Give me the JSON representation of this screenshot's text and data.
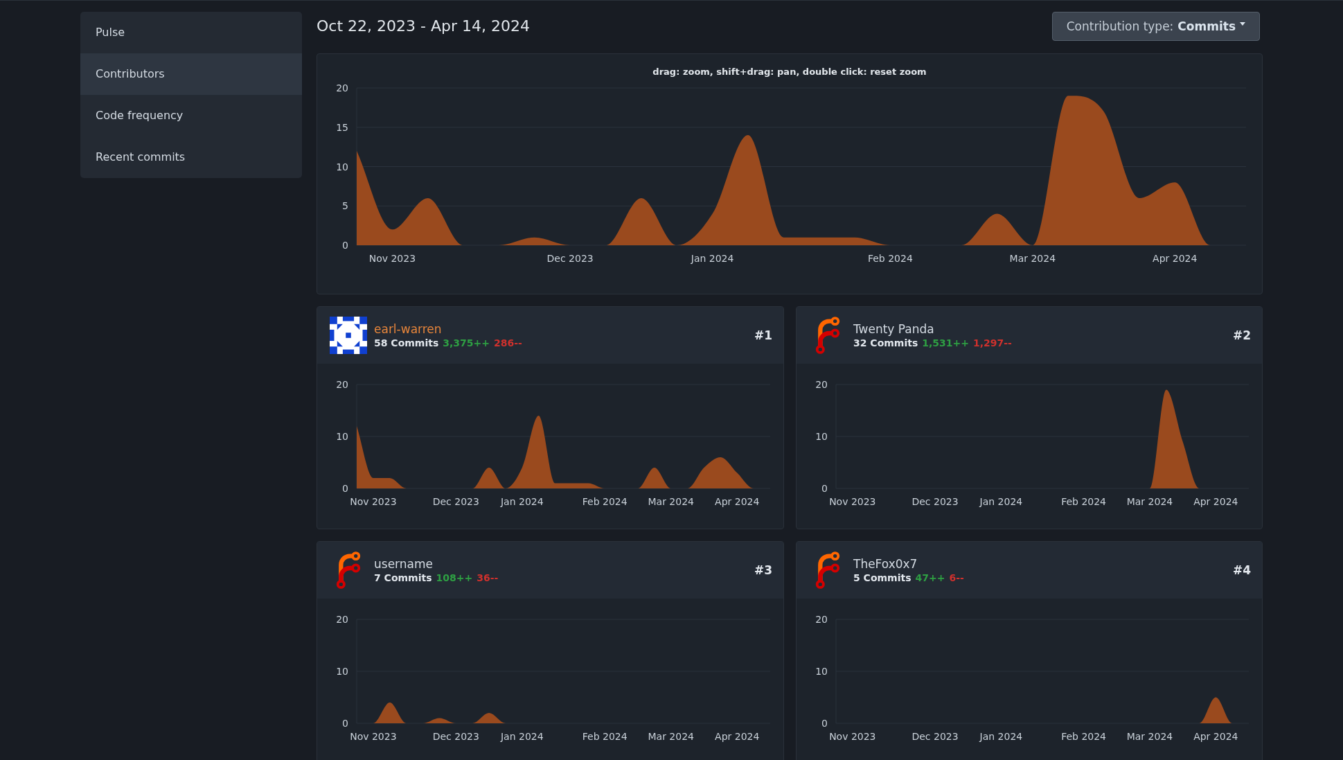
{
  "sidebar": {
    "items": [
      {
        "label": "Pulse",
        "selected": false
      },
      {
        "label": "Contributors",
        "selected": true
      },
      {
        "label": "Code frequency",
        "selected": false
      },
      {
        "label": "Recent commits",
        "selected": false
      }
    ]
  },
  "header": {
    "date_range": "Oct 22, 2023 - Apr 14, 2024",
    "contribution_button": {
      "label": "Contribution type:",
      "value": "Commits"
    }
  },
  "main_chart": {
    "chart_data": {
      "type": "area",
      "title": "drag: zoom, shift+drag: pan, double click: reset zoom",
      "categories": [
        null,
        "Nov 2023",
        null,
        null,
        null,
        null,
        "Dec 2023",
        null,
        null,
        null,
        "Jan 2024",
        null,
        null,
        null,
        null,
        "Feb 2024",
        null,
        null,
        null,
        "Mar 2024",
        null,
        null,
        null,
        "Apr 2024",
        null,
        null
      ],
      "values": [
        12,
        2,
        6,
        0,
        0,
        1,
        0,
        0,
        6,
        0,
        4,
        14,
        1,
        1,
        1,
        0,
        0,
        0,
        4,
        0,
        19,
        17,
        6,
        8,
        0,
        0
      ],
      "ylim": [
        0,
        20
      ],
      "yticks": [
        0,
        5,
        10,
        15,
        20
      ],
      "grid": true
    }
  },
  "contributors": [
    {
      "kind": "identicon",
      "name": "earl-warren",
      "link": true,
      "commits": "58 Commits",
      "additions": "3,375++",
      "deletions": "286--",
      "rank": "#1",
      "chart_data": {
        "type": "area",
        "categories": [
          null,
          "Nov 2023",
          null,
          null,
          null,
          null,
          "Dec 2023",
          null,
          null,
          null,
          "Jan 2024",
          null,
          null,
          null,
          null,
          "Feb 2024",
          null,
          null,
          null,
          "Mar 2024",
          null,
          null,
          null,
          "Apr 2024",
          null,
          null
        ],
        "values": [
          12,
          2,
          2,
          0,
          0,
          0,
          0,
          0,
          4,
          0,
          4,
          14,
          1,
          1,
          1,
          0,
          0,
          0,
          4,
          0,
          0,
          4,
          6,
          3,
          0,
          0
        ],
        "ylim": [
          0,
          20
        ],
        "yticks": [
          0,
          10,
          20
        ],
        "grid": true
      }
    },
    {
      "kind": "default",
      "name": "Twenty Panda",
      "link": false,
      "commits": "32 Commits",
      "additions": "1,531++",
      "deletions": "1,297--",
      "rank": "#2",
      "chart_data": {
        "type": "area",
        "categories": [
          null,
          "Nov 2023",
          null,
          null,
          null,
          null,
          "Dec 2023",
          null,
          null,
          null,
          "Jan 2024",
          null,
          null,
          null,
          null,
          "Feb 2024",
          null,
          null,
          null,
          "Mar 2024",
          null,
          null,
          null,
          "Apr 2024",
          null,
          null
        ],
        "values": [
          0,
          0,
          0,
          0,
          0,
          0,
          0,
          0,
          0,
          0,
          0,
          0,
          0,
          0,
          0,
          0,
          0,
          0,
          0,
          0,
          19,
          9,
          0,
          0,
          0,
          0
        ],
        "ylim": [
          0,
          20
        ],
        "yticks": [
          0,
          10,
          20
        ],
        "grid": true
      }
    },
    {
      "kind": "default",
      "name": "username",
      "link": false,
      "commits": "7 Commits",
      "additions": "108++",
      "deletions": "36--",
      "rank": "#3",
      "chart_data": {
        "type": "area",
        "categories": [
          null,
          "Nov 2023",
          null,
          null,
          null,
          null,
          "Dec 2023",
          null,
          null,
          null,
          "Jan 2024",
          null,
          null,
          null,
          null,
          "Feb 2024",
          null,
          null,
          null,
          "Mar 2024",
          null,
          null,
          null,
          "Apr 2024",
          null,
          null
        ],
        "values": [
          0,
          0,
          4,
          0,
          0,
          1,
          0,
          0,
          2,
          0,
          0,
          0,
          0,
          0,
          0,
          0,
          0,
          0,
          0,
          0,
          0,
          0,
          0,
          0,
          0,
          0
        ],
        "ylim": [
          0,
          20
        ],
        "yticks": [
          0,
          10,
          20
        ],
        "grid": true
      }
    },
    {
      "kind": "default",
      "name": "TheFox0x7",
      "link": false,
      "commits": "5 Commits",
      "additions": "47++",
      "deletions": "6--",
      "rank": "#4",
      "chart_data": {
        "type": "area",
        "categories": [
          null,
          "Nov 2023",
          null,
          null,
          null,
          null,
          "Dec 2023",
          null,
          null,
          null,
          "Jan 2024",
          null,
          null,
          null,
          null,
          "Feb 2024",
          null,
          null,
          null,
          "Mar 2024",
          null,
          null,
          null,
          "Apr 2024",
          null,
          null
        ],
        "values": [
          0,
          0,
          0,
          0,
          0,
          0,
          0,
          0,
          0,
          0,
          0,
          0,
          0,
          0,
          0,
          0,
          0,
          0,
          0,
          0,
          0,
          0,
          0,
          5,
          0,
          0
        ],
        "ylim": [
          0,
          20
        ],
        "yticks": [
          0,
          10,
          20
        ],
        "grid": true
      }
    }
  ]
}
